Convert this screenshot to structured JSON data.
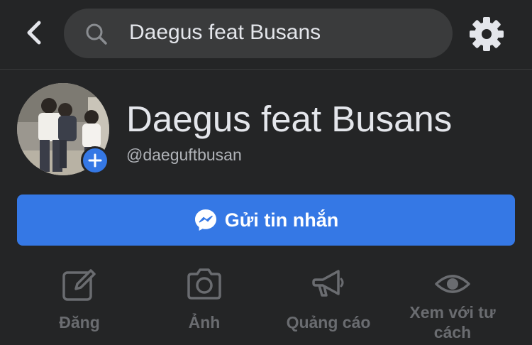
{
  "search": {
    "query": "Daegus feat Busans"
  },
  "profile": {
    "name": "Daegus feat Busans",
    "handle": "@daeguftbusan"
  },
  "primary_action": {
    "label": "Gửi tin nhắn"
  },
  "actions": [
    {
      "label": "Đăng",
      "icon": "edit-icon"
    },
    {
      "label": "Ảnh",
      "icon": "camera-icon"
    },
    {
      "label": "Quảng cáo",
      "icon": "megaphone-icon"
    },
    {
      "label": "Xem với tư cách",
      "icon": "eye-icon"
    }
  ],
  "colors": {
    "background": "#242526",
    "search_bg": "#3a3b3c",
    "accent": "#3578e5",
    "text_primary": "#e4e6eb",
    "text_secondary": "#b0b3b8",
    "action_muted": "#6a6c70"
  }
}
